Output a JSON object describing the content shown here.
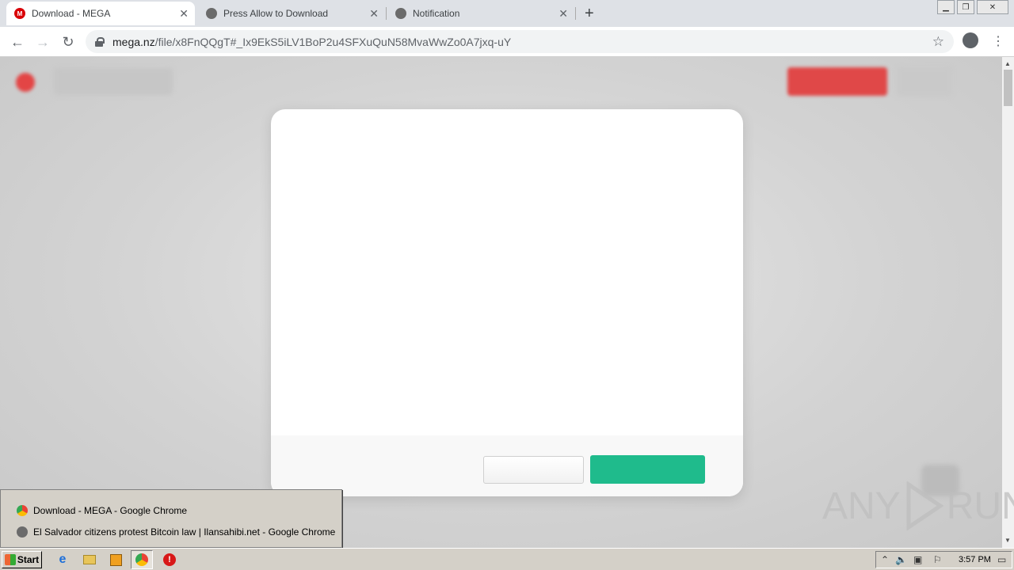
{
  "browser": {
    "tabs": [
      {
        "label": "Download - MEGA",
        "icon": "mega-logo-icon",
        "active": true
      },
      {
        "label": "Press Allow to Download",
        "icon": "globe-icon",
        "active": false
      },
      {
        "label": "Notification",
        "icon": "globe-icon",
        "active": false
      }
    ],
    "url_host": "mega.nz",
    "url_path": "/file/x8FnQQgT#_Ix9EkS5iLV1BoP2u4SFXuQuN58MvaWwZo0A7jxq-uY"
  },
  "taskbar_popup": {
    "items": [
      {
        "label": "Download - MEGA - Google Chrome",
        "icon": "chrome-icon"
      },
      {
        "label": "El Salvador citizens protest Bitcoin law | Ilansahibi.net - Google Chrome",
        "icon": "globe-icon"
      }
    ]
  },
  "watermark": {
    "left": "ANY",
    "right": "RUN"
  },
  "taskbar": {
    "start_label": "Start",
    "clock": "3:57 PM"
  },
  "colors": {
    "mega_red": "#d90007",
    "modal_confirm": "#1fbb8c",
    "page_overlay": "#d9d9d9"
  }
}
